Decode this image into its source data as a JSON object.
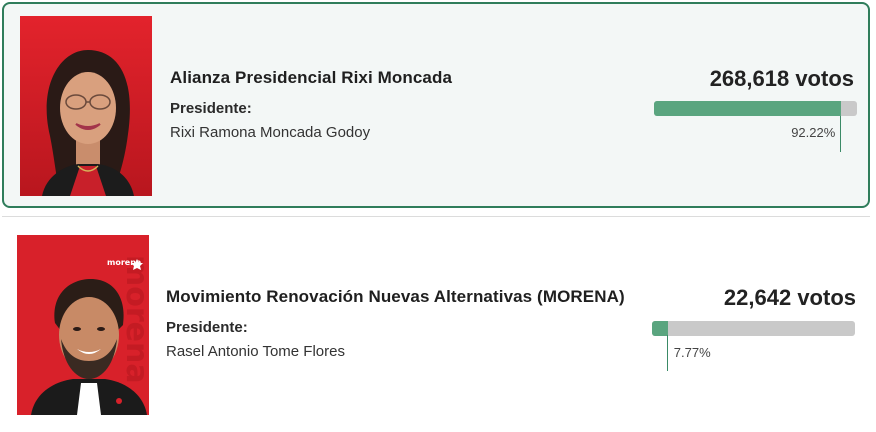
{
  "candidates": [
    {
      "party": "Alianza Presidencial Rixi Moncada",
      "role": "Presidente:",
      "name": "Rixi Ramona Moncada Godoy",
      "votes": "268,618 votos",
      "percent_label": "92.22%",
      "percent": 92.22,
      "leading": true
    },
    {
      "party": "Movimiento Renovación Nuevas Alternativas (MORENA)",
      "role": "Presidente:",
      "name": "Rasel Antonio Tome Flores",
      "votes": "22,642 votos",
      "percent_label": "7.77%",
      "percent": 7.77,
      "photo_logo": "morena",
      "photo_watermark": "morena",
      "leading": false
    }
  ],
  "colors": {
    "accent": "#2f7d5b",
    "bar_fill": "#5aa57f",
    "bar_track": "#c9c9c9",
    "photo_background": "#d8212a"
  }
}
